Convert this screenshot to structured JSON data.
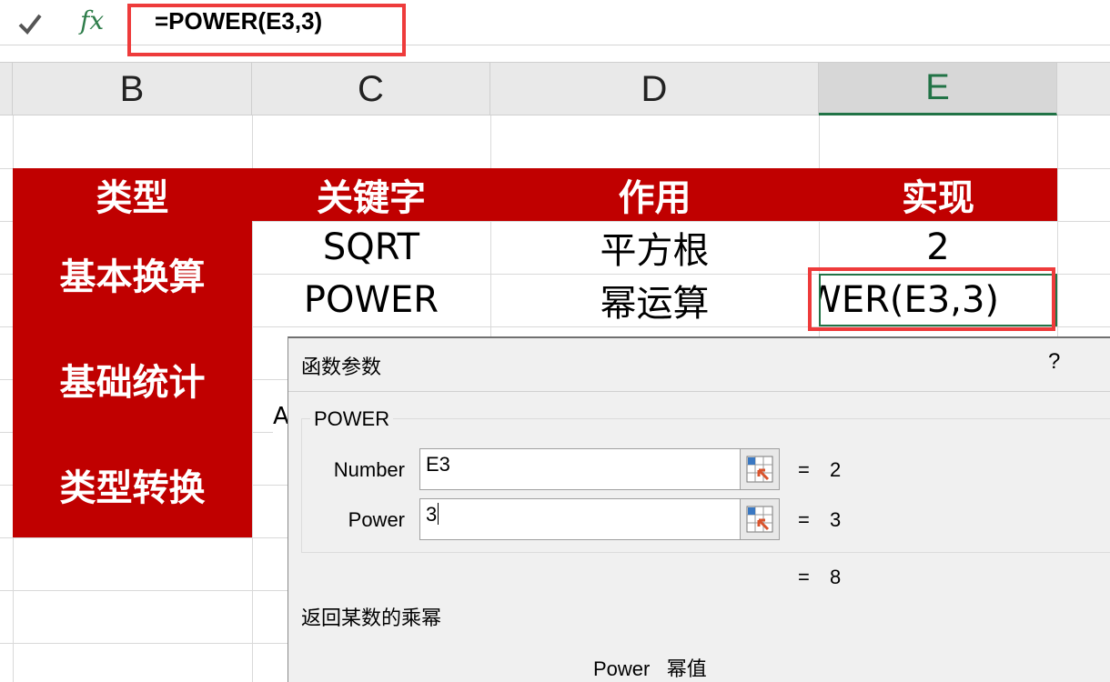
{
  "formula_bar": {
    "confirm_icon": "check-icon",
    "fx_label": "fx",
    "formula": "=POWER(E3,3)"
  },
  "columns": [
    {
      "label": "B"
    },
    {
      "label": "C"
    },
    {
      "label": "D"
    },
    {
      "label": "E",
      "selected": true
    }
  ],
  "table": {
    "headers": [
      "类型",
      "关键字",
      "作用",
      "实现"
    ],
    "categories": [
      "基本换算",
      "基础统计",
      "类型转换"
    ],
    "rows": [
      {
        "keyword": "SQRT",
        "usage": "平方根",
        "result": "2"
      },
      {
        "keyword": "POWER",
        "usage": "幂运算",
        "result": "WER(E3,3)"
      }
    ],
    "partial_text": "A"
  },
  "dialog": {
    "title": "函数参数",
    "help": "?",
    "function_name": "POWER",
    "args": [
      {
        "label": "Number",
        "value": "E3",
        "result": "2"
      },
      {
        "label": "Power",
        "value": "3",
        "result": "3"
      }
    ],
    "equals": "=",
    "total_result": "8",
    "description": "返回某数的乘幂",
    "arg_description": "Power   幂值"
  },
  "colors": {
    "header_red": "#c00000",
    "excel_green": "#217346",
    "highlight_red": "#ee3b3b"
  }
}
